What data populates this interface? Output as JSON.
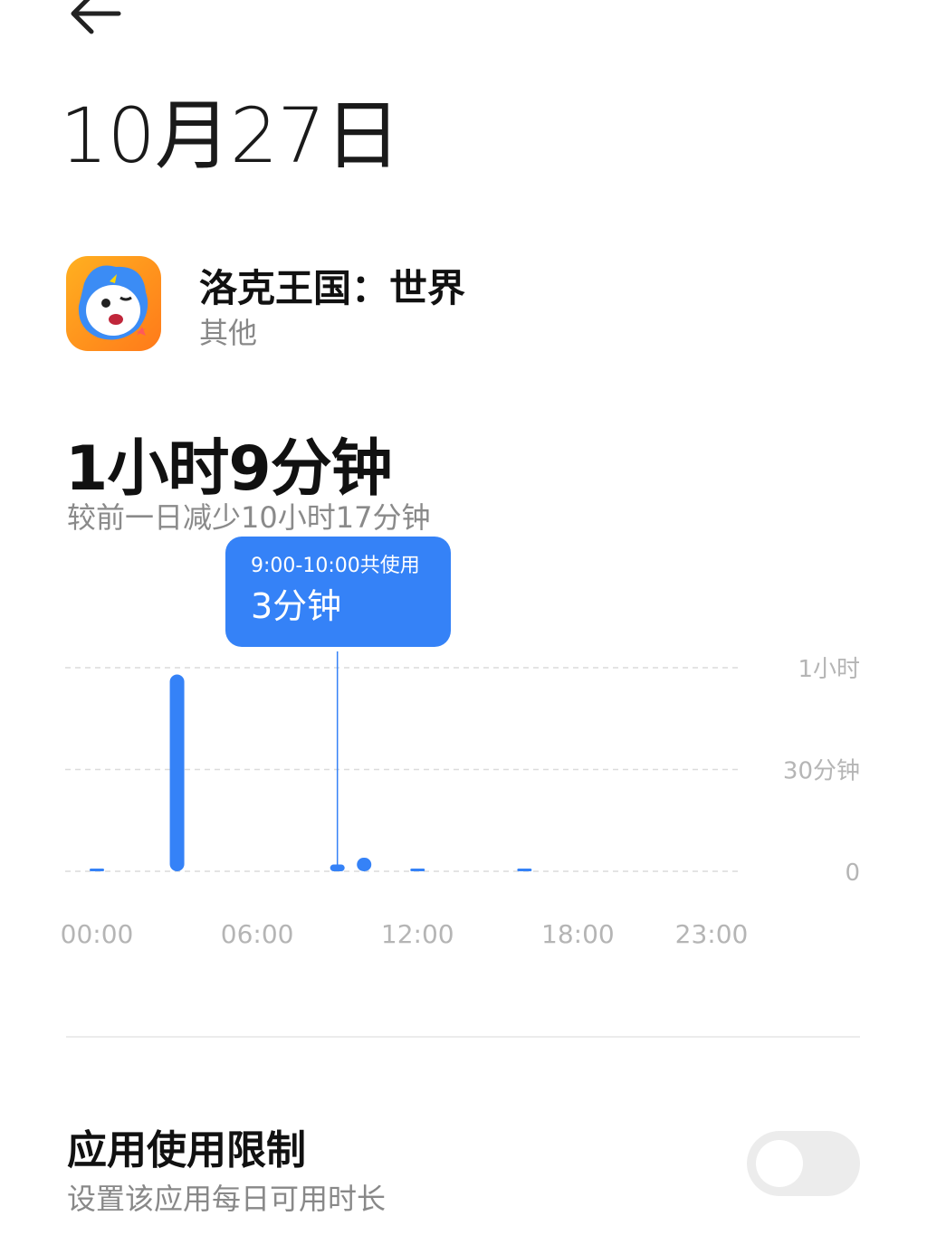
{
  "header": {
    "title": "10月27日"
  },
  "app": {
    "name": "洛克王国：世界",
    "category": "其他",
    "icon": "roco-kingdom-app-icon"
  },
  "usage": {
    "total": "1小时9分钟",
    "compare": "较前一日减少10小时17分钟"
  },
  "tooltip": {
    "range": "9:00-10:00共使用",
    "value": "3分钟"
  },
  "colors": {
    "accent": "#3582f7",
    "grid": "#dcdcdc",
    "axis_text": "#b5b5b5"
  },
  "chart_data": {
    "type": "bar",
    "x": [
      0,
      3,
      9,
      10,
      12,
      16
    ],
    "values": [
      0.3,
      58,
      2,
      4,
      0.3,
      0.3
    ],
    "selected_index": 2,
    "xlim": [
      0,
      23
    ],
    "ylim": [
      0,
      60
    ],
    "x_ticks": [
      {
        "value": 0,
        "label": "00:00"
      },
      {
        "value": 6,
        "label": "06:00"
      },
      {
        "value": 12,
        "label": "12:00"
      },
      {
        "value": 18,
        "label": "18:00"
      },
      {
        "value": 23,
        "label": "23:00"
      }
    ],
    "y_ticks": [
      {
        "value": 60,
        "label": "1小时"
      },
      {
        "value": 30,
        "label": "30分钟"
      },
      {
        "value": 0,
        "label": "0"
      }
    ],
    "grid": true
  },
  "limit": {
    "title": "应用使用限制",
    "description": "设置该应用每日可用时长",
    "enabled": false
  }
}
